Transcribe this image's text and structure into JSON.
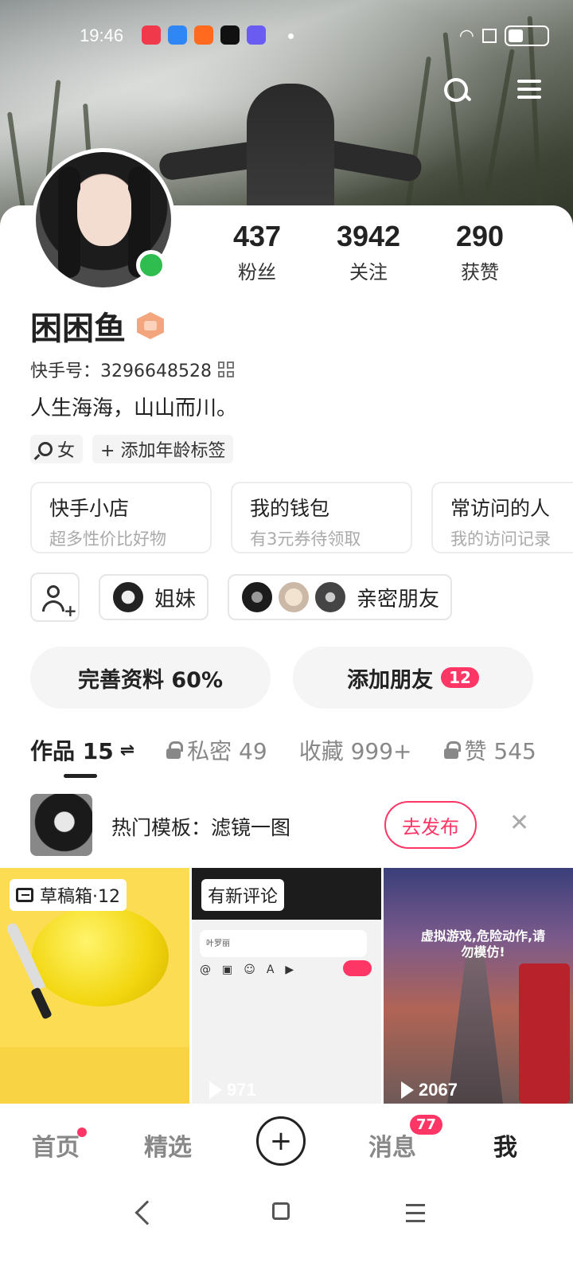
{
  "status_bar": {
    "time": "19:46"
  },
  "profile": {
    "stats": [
      {
        "value": "437",
        "label": "粉丝"
      },
      {
        "value": "3942",
        "label": "关注"
      },
      {
        "value": "290",
        "label": "获赞"
      }
    ],
    "nickname": "困困鱼",
    "ks_id": "快手号：3296648528",
    "bio": "人生海海，山山而川。",
    "tags": {
      "gender": "女",
      "add_age": "+ 添加年龄标签"
    }
  },
  "cards": [
    {
      "title": "快手小店",
      "subtitle": "超多性价比好物"
    },
    {
      "title": "我的钱包",
      "subtitle": "有3元券待领取"
    },
    {
      "title": "常访问的人",
      "subtitle": "我的访问记录"
    }
  ],
  "friends": {
    "sisters": "姐妹",
    "close": "亲密朋友"
  },
  "actions": {
    "complete_profile": "完善资料 60%",
    "add_friends": "添加朋友",
    "add_friends_badge": "12"
  },
  "tabs": [
    {
      "label": "作品 15"
    },
    {
      "label": "私密 49"
    },
    {
      "label": "收藏 999+"
    },
    {
      "label": "赞 545"
    }
  ],
  "template_bar": {
    "text": "热门模板：滤镜一图",
    "publish": "去发布"
  },
  "grid": {
    "tile1_label": "草稿箱·12",
    "tile2_label": "有新评论",
    "tile2_input": "叶罗丽",
    "tile2_plays": "971",
    "tile3_caption": "虚拟游戏,危险动作,请勿模仿!",
    "tile3_plays": "2067"
  },
  "bottom_nav": {
    "home": "首页",
    "featured": "精选",
    "messages": "消息",
    "messages_badge": "77",
    "me": "我"
  },
  "colors": {
    "accent": "#fe3666",
    "online": "#2fbd4f",
    "badge": "#f3a57d"
  }
}
